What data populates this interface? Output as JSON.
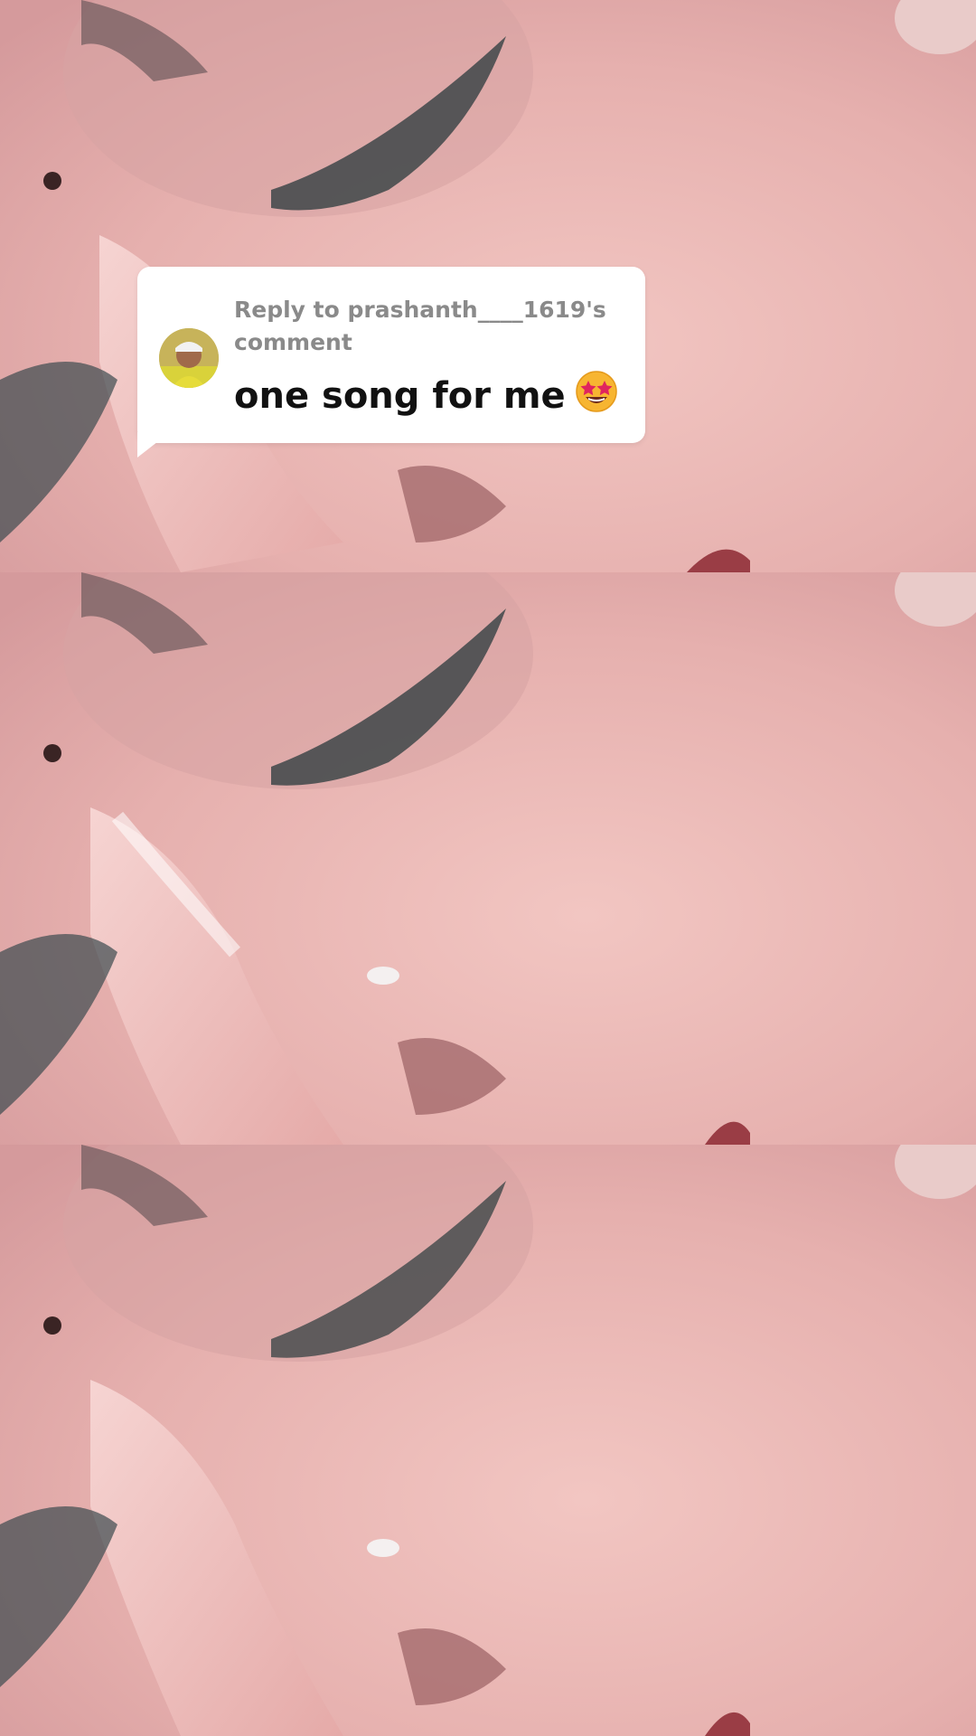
{
  "comment_reply": {
    "header": "Reply to prashanth____1619's comment",
    "text": "one song for me",
    "emoji_icon": "star-struck-emoji-icon"
  },
  "colors": {
    "skin": "#e8b4b4",
    "card_bg": "#ffffff",
    "header_text": "#8a8a8a",
    "body_text": "#111111"
  }
}
